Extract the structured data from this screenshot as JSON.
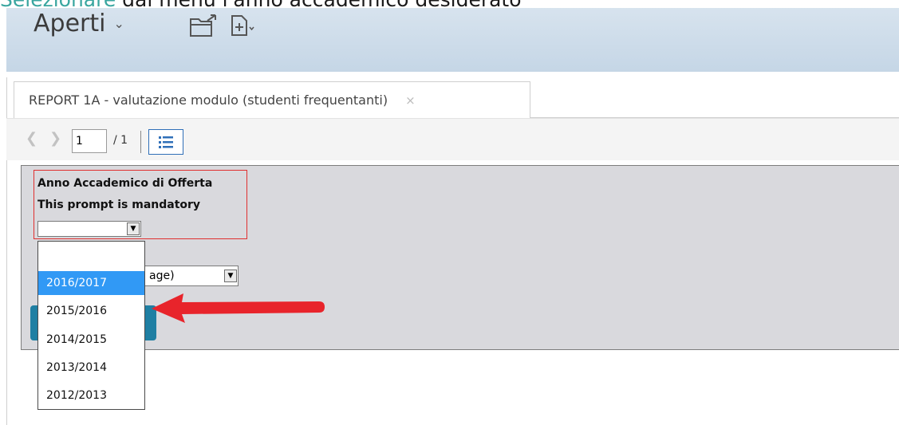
{
  "caption": {
    "highlight": "Selezionare",
    "rest": " dal menù l'anno accademico desiderato"
  },
  "header": {
    "aperti_label": "Aperti"
  },
  "tab": {
    "title": "REPORT 1A - valutazione modulo (studenti frequentanti)",
    "close": "×"
  },
  "pager": {
    "current": "1",
    "total": "/ 1"
  },
  "prompt": {
    "label1": "Anno Accademico di Offerta",
    "label2": "This prompt is mandatory",
    "selected_value": "",
    "options": [
      "",
      "2016/2017",
      "2015/2016",
      "2014/2015",
      "2013/2014",
      "2012/2013"
    ],
    "highlighted_option": "2016/2017"
  },
  "format_select": {
    "visible_text": "age)"
  },
  "colors": {
    "accent": "#3199f5",
    "red_highlight": "#e03030",
    "button": "#1f7fa3"
  }
}
